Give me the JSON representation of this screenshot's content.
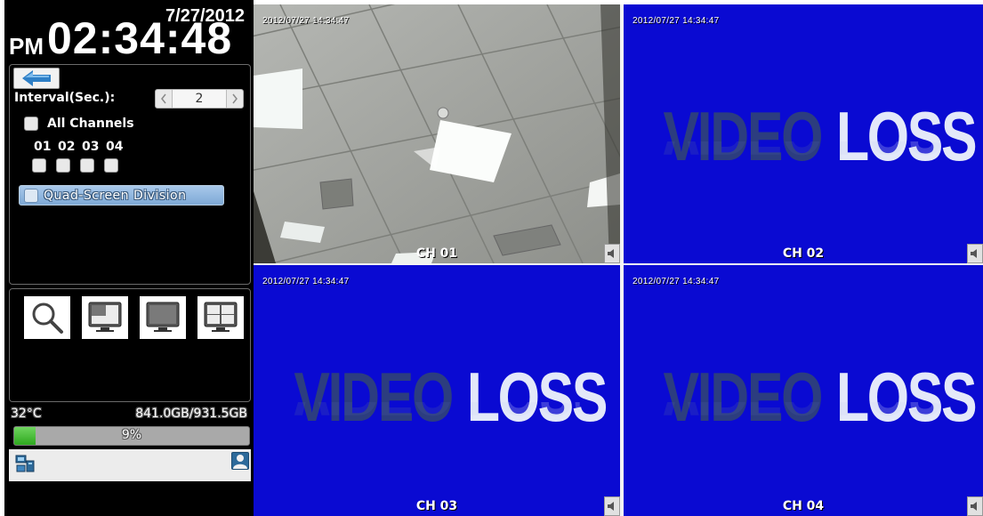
{
  "clock": {
    "date": "7/27/2012",
    "ampm": "PM",
    "time": "02:34:48"
  },
  "controls": {
    "interval_label": "Interval(Sec.):",
    "interval_value": "2",
    "all_channels_label": "All Channels",
    "channel_numbers": [
      "01",
      "02",
      "03",
      "04"
    ],
    "quad_label": "Quad-Screen Division"
  },
  "view_buttons": [
    "search-icon",
    "pip-view-icon",
    "single-view-icon",
    "quad-view-icon"
  ],
  "status": {
    "temperature": "32°C",
    "storage": "841.0GB/931.5GB",
    "hdd_percent_label": "9%",
    "hdd_fraction": 0.09
  },
  "cameras": [
    {
      "timestamp": "2012/07/27 14:34:47",
      "channel": "CH 01"
    },
    {
      "timestamp": "2012/07/27 14:34:47",
      "channel": "CH 02",
      "message_a": "VIDEO",
      "message_b": "LOSS"
    },
    {
      "timestamp": "2012/07/27 14:34:47",
      "channel": "CH 03",
      "message_a": "VIDEO",
      "message_b": "LOSS"
    },
    {
      "timestamp": "2012/07/27 14:34:47",
      "channel": "CH 04",
      "message_a": "VIDEO",
      "message_b": "LOSS"
    }
  ],
  "colors": {
    "video_loss_bg": "#0a0ad2",
    "hdd_fill": "#3cb52b",
    "quad_button": "#8fb6e0"
  }
}
